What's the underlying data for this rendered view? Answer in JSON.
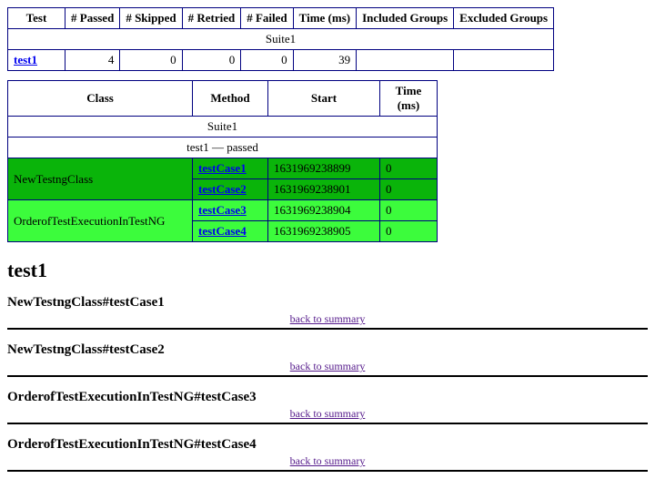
{
  "summary": {
    "headers": {
      "test": "Test",
      "passed": "# Passed",
      "skipped": "# Skipped",
      "retried": "# Retried",
      "failed": "# Failed",
      "time": "Time (ms)",
      "included": "Included Groups",
      "excluded": "Excluded Groups"
    },
    "suite": "Suite1",
    "row": {
      "test": "test1",
      "passed": "4",
      "skipped": "0",
      "retried": "0",
      "failed": "0",
      "time": "39",
      "included": "",
      "excluded": ""
    }
  },
  "detail": {
    "headers": {
      "class": "Class",
      "method": "Method",
      "start": "Start",
      "time": "Time (ms)"
    },
    "suite": "Suite1",
    "status_line": "test1 — passed",
    "rows": [
      {
        "class": "NewTestngClass",
        "method": "testCase1",
        "start": "1631969238899",
        "time": "0",
        "shade": "dark",
        "show_class": true
      },
      {
        "class": "NewTestngClass",
        "method": "testCase2",
        "start": "1631969238901",
        "time": "0",
        "shade": "dark",
        "show_class": false
      },
      {
        "class": "OrderofTestExecutionInTestNG",
        "method": "testCase3",
        "start": "1631969238904",
        "time": "0",
        "shade": "light",
        "show_class": true
      },
      {
        "class": "OrderofTestExecutionInTestNG",
        "method": "testCase4",
        "start": "1631969238905",
        "time": "0",
        "shade": "light",
        "show_class": false
      }
    ]
  },
  "section": {
    "title": "test1",
    "back_label": "back to summary",
    "cases": [
      {
        "title": "NewTestngClass#testCase1"
      },
      {
        "title": "NewTestngClass#testCase2"
      },
      {
        "title": "OrderofTestExecutionInTestNG#testCase3"
      },
      {
        "title": "OrderofTestExecutionInTestNG#testCase4"
      }
    ]
  }
}
